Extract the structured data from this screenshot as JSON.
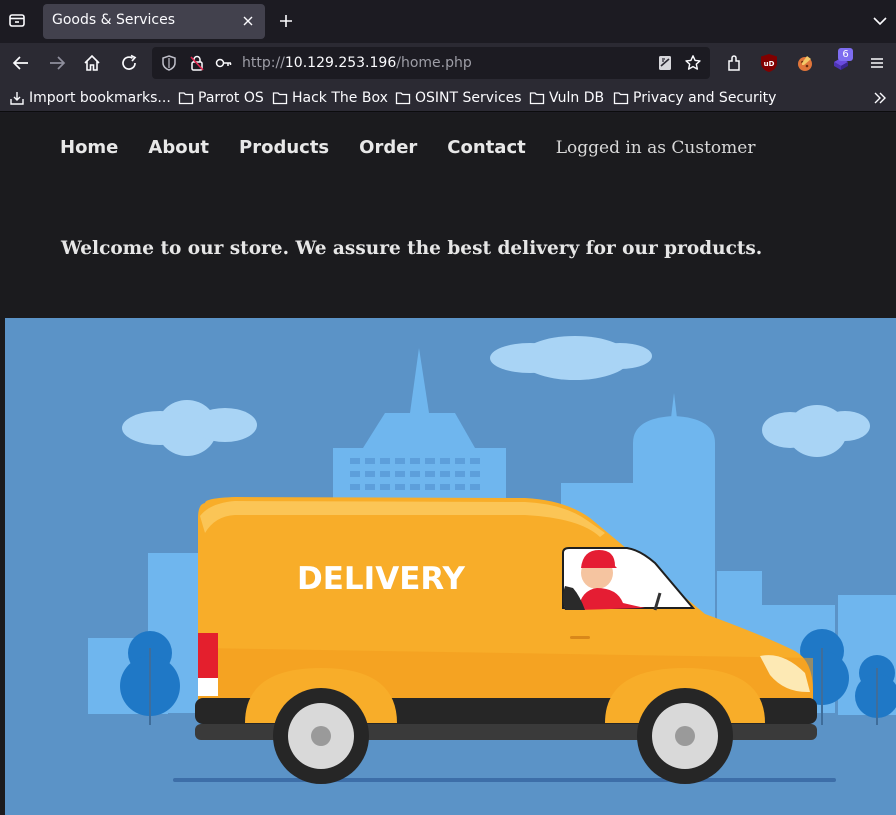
{
  "browser": {
    "tab_title": "Goods & Services",
    "url_scheme": "http://",
    "url_host": "10.129.253.196",
    "url_path": "/home.php",
    "extension_badge": "6",
    "bookmarks": [
      {
        "label": "Import bookmarks...",
        "icon": "import-icon"
      },
      {
        "label": "Parrot OS",
        "icon": "folder-icon"
      },
      {
        "label": "Hack The Box",
        "icon": "folder-icon"
      },
      {
        "label": "OSINT Services",
        "icon": "folder-icon"
      },
      {
        "label": "Vuln DB",
        "icon": "folder-icon"
      },
      {
        "label": "Privacy and Security",
        "icon": "folder-icon"
      }
    ]
  },
  "site": {
    "nav": [
      "Home",
      "About",
      "Products",
      "Order",
      "Contact"
    ],
    "logged_in": "Logged in as Customer",
    "welcome": "Welcome to our store. We assure the best delivery for our products.",
    "hero_van_text": "DELIVERY"
  },
  "colors": {
    "sky": "#5a93c8",
    "building": "#6bb4ee",
    "van": "#f9ad2a",
    "tree": "#1f78c6"
  }
}
